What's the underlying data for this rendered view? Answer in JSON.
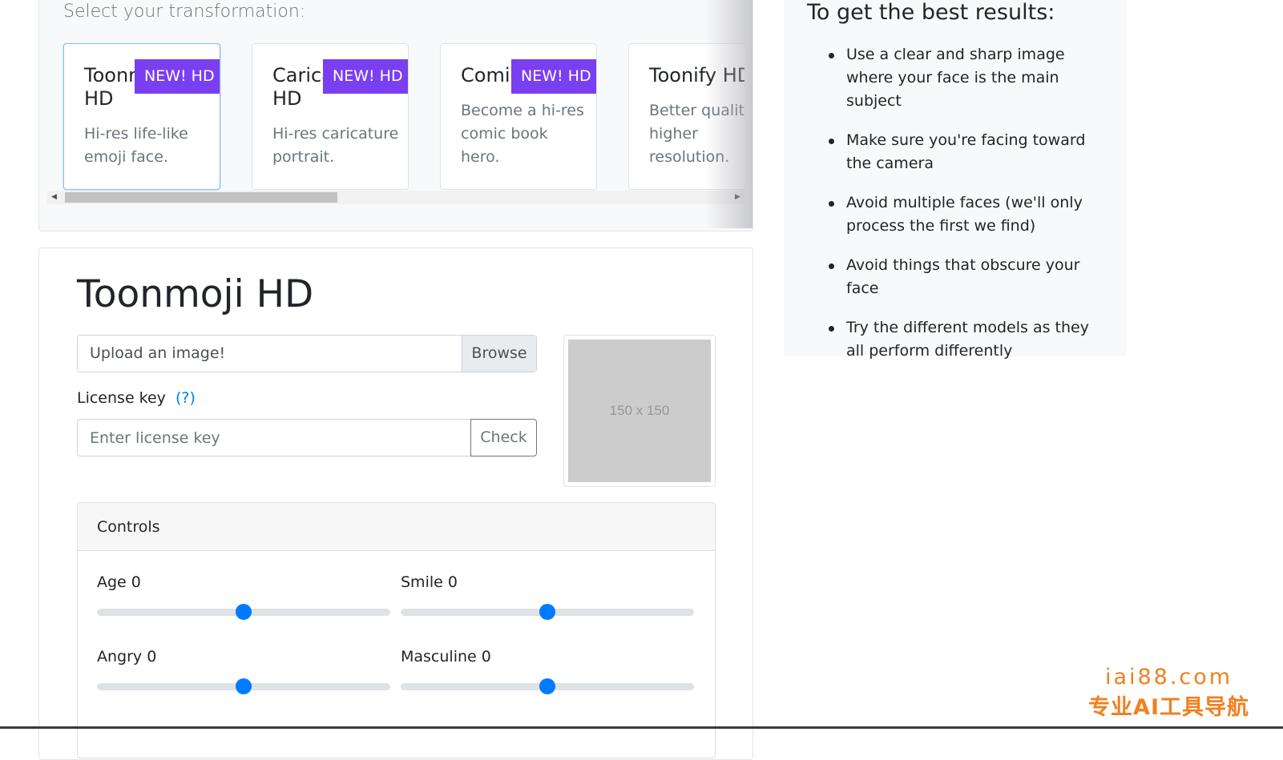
{
  "transform_panel": {
    "title": "Select your transformation:",
    "cards": [
      {
        "title": "Toonmoji HD",
        "badge": "NEW! HD",
        "desc": "Hi-res life-like emoji face.",
        "active": true
      },
      {
        "title": "Caricature HD",
        "badge": "NEW! HD",
        "desc": "Hi-res caricature portrait.",
        "active": false
      },
      {
        "title": "Comic HD",
        "badge": "NEW! HD",
        "desc": "Become a hi-res comic book hero.",
        "active": false
      },
      {
        "title": "Toonify HD",
        "badge": "",
        "desc": "Better quality, higher resolution.",
        "active": false
      }
    ]
  },
  "main": {
    "title": "Toonmoji HD",
    "upload_text": "Upload an image!",
    "browse_label": "Browse",
    "license_label": "License key",
    "license_help": "(?)",
    "license_placeholder": "Enter license key",
    "check_label": "Check",
    "preview_text": "150 x 150",
    "controls": {
      "header": "Controls",
      "sliders": [
        {
          "label": "Age 0",
          "value_fraction": 0.5
        },
        {
          "label": "Smile 0",
          "value_fraction": 0.5
        },
        {
          "label": "Angry 0",
          "value_fraction": 0.5
        },
        {
          "label": "Masculine 0",
          "value_fraction": 0.5
        }
      ]
    }
  },
  "tips": {
    "title": "To get the best results:",
    "items": [
      "Use a clear and sharp image where your face is the main subject",
      "Make sure you're facing toward the camera",
      "Avoid multiple faces (we'll only process the first we find)",
      "Avoid things that obscure your face",
      "Try the different models as they all perform differently"
    ]
  },
  "watermark": {
    "line1": "iai88.com",
    "line2": "专业AI工具导航"
  },
  "colors": {
    "accent": "#007bff",
    "badge": "#7a3ff0"
  }
}
